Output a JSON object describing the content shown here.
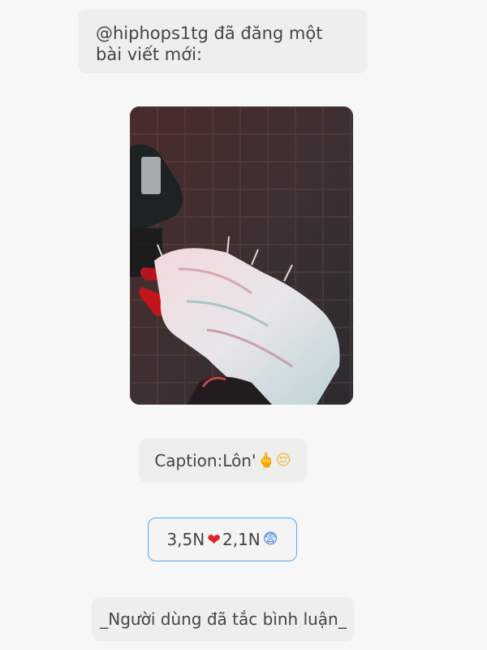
{
  "post_notice": {
    "text": "@hiphops1tg đã đăng một bài viết mới:"
  },
  "photo": {
    "description_icon": "bandaged-hand-photo"
  },
  "caption": {
    "label": "Caption:Lôn'",
    "emoji_1": "🖕",
    "emoji_2": "😔"
  },
  "stats": {
    "likes": "3,5N",
    "like_emoji": "❤",
    "reactions": "2,1N",
    "reaction_emoji": "😨"
  },
  "footer": {
    "text": "_Người dùng đã tắc bình luận_"
  },
  "colors": {
    "background": "#f7f7f7",
    "bubble": "#eeeeee",
    "stats_border": "#5aa6e8",
    "heart": "#e0202a"
  }
}
